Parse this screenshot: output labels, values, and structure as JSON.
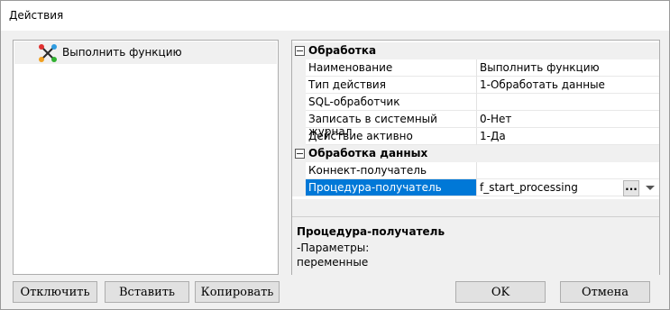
{
  "window": {
    "title": "Действия"
  },
  "tree": {
    "items": [
      {
        "label": "Выполнить функцию",
        "icon": "function-node-icon"
      }
    ]
  },
  "properties": {
    "categories": [
      {
        "label": "Обработка",
        "rows": [
          {
            "name": "Наименование",
            "value": "Выполнить функцию"
          },
          {
            "name": "Тип действия",
            "value": "1-Обработать данные"
          },
          {
            "name": "SQL-обработчик",
            "value": ""
          },
          {
            "name": "Записать в системный журнал",
            "value": "0-Нет"
          },
          {
            "name": "Действие активно",
            "value": "1-Да"
          }
        ]
      },
      {
        "label": "Обработка данных",
        "rows": [
          {
            "name": "Коннект-получатель",
            "value": ""
          },
          {
            "name": "Процедура-получатель",
            "value": "f_start_processing",
            "selected": true
          }
        ]
      }
    ],
    "ellipsis_label": "...",
    "description": {
      "title": "Процедура-получатель",
      "line1": "-Параметры:",
      "line2": "переменные"
    }
  },
  "buttons": {
    "disable": "Отключить",
    "insert": "Вставить",
    "copy": "Копировать",
    "ok": "OK",
    "cancel": "Отмена"
  },
  "colors": {
    "selection": "#0078d7",
    "background": "#f0f0f0"
  }
}
